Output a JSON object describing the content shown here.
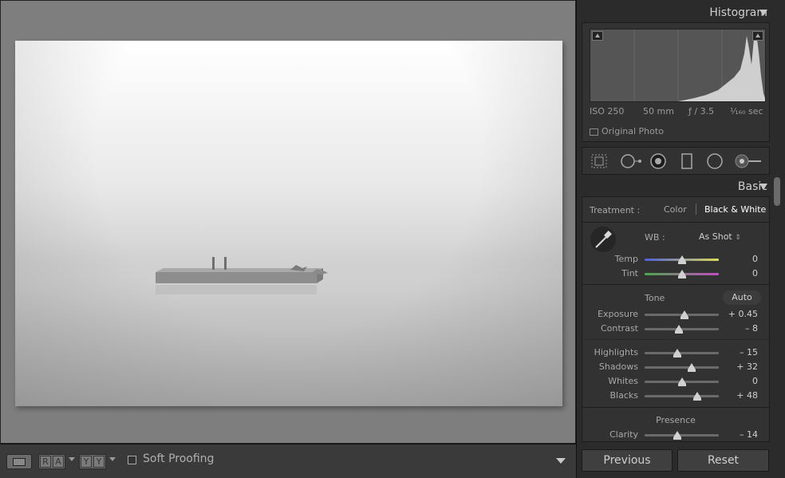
{
  "toolbar": {
    "view_mode_icon": "loupe-view-icon",
    "compare_a": "R",
    "compare_b": "A",
    "survey_a": "Y",
    "survey_b": "Y",
    "soft_proofing_label": "Soft Proofing",
    "soft_proofing_checked": false
  },
  "histogram": {
    "title": "Histogram",
    "iso": "ISO 250",
    "focal": "50 mm",
    "aperture": "ƒ / 3.5",
    "shutter": "¹⁄₁₆₀ sec",
    "original_photo_label": "Original Photo"
  },
  "tools": [
    "crop-icon",
    "spot-removal-icon",
    "red-eye-icon",
    "graduated-filter-icon",
    "radial-filter-icon",
    "adjustment-brush-icon"
  ],
  "basic": {
    "title": "Basic",
    "treatment_label": "Treatment :",
    "treatment_color": "Color",
    "treatment_bw": "Black & White",
    "wb_label": "WB :",
    "wb_value": "As Shot",
    "temp_label": "Temp",
    "temp_value": "0",
    "tint_label": "Tint",
    "tint_value": "0",
    "tone_label": "Tone",
    "auto_label": "Auto",
    "exposure_label": "Exposure",
    "exposure_value": "+ 0.45",
    "contrast_label": "Contrast",
    "contrast_value": "– 8",
    "highlights_label": "Highlights",
    "highlights_value": "– 15",
    "shadows_label": "Shadows",
    "shadows_value": "+ 32",
    "whites_label": "Whites",
    "whites_value": "0",
    "blacks_label": "Blacks",
    "blacks_value": "+ 48",
    "presence_label": "Presence",
    "clarity_label": "Clarity",
    "clarity_value": "– 14"
  },
  "buttons": {
    "previous": "Previous",
    "reset": "Reset"
  }
}
